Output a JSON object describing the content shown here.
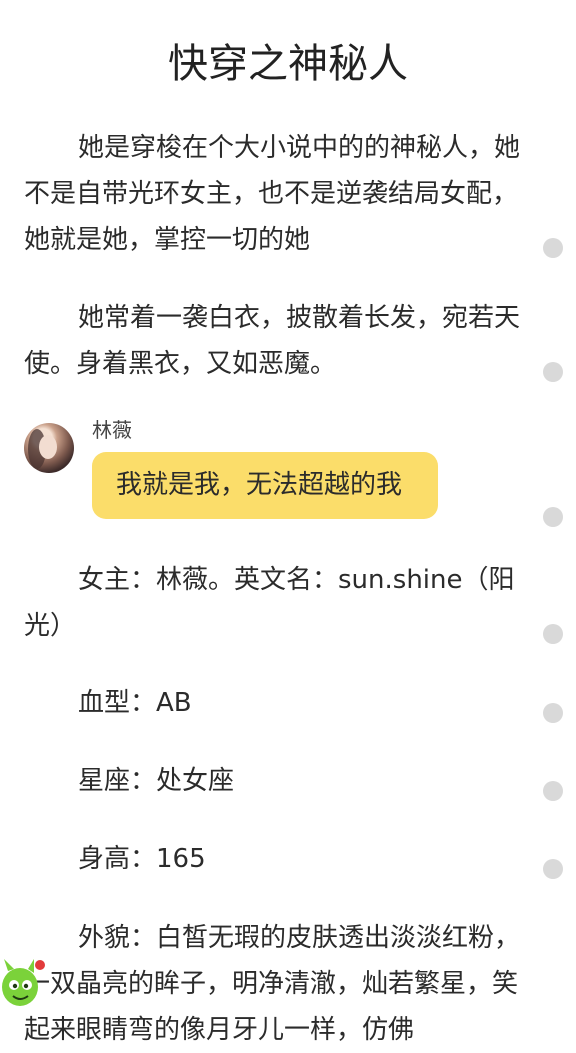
{
  "article": {
    "title": "快穿之神秘人",
    "paragraphs": [
      "她是穿梭在个大小说中的的神秘人，她不是自带光环女主，也不是逆袭结局女配，她就是她，掌控一切的她",
      "她常着一袭白衣，披散着长发，宛若天使。身着黑衣，又如恶魔。"
    ],
    "dialogue": {
      "speaker": "林薇",
      "text": "我就是我，无法超越的我"
    },
    "profile": [
      "女主：林薇。英文名：sun.shine（阳光）",
      "血型：AB",
      "星座：处女座",
      "身高：165",
      "外貌：白皙无瑕的皮肤透出淡淡红粉，一双晶亮的眸子，明净清澈，灿若繁星，笑起来眼睛弯的像月牙儿一样，仿佛"
    ]
  },
  "colors": {
    "bubble": "#fbdd6a",
    "comment_dot": "#d9d9d9"
  },
  "icons": {
    "avatar": "avatar-photo",
    "mascot": "green-mascot-icon"
  }
}
